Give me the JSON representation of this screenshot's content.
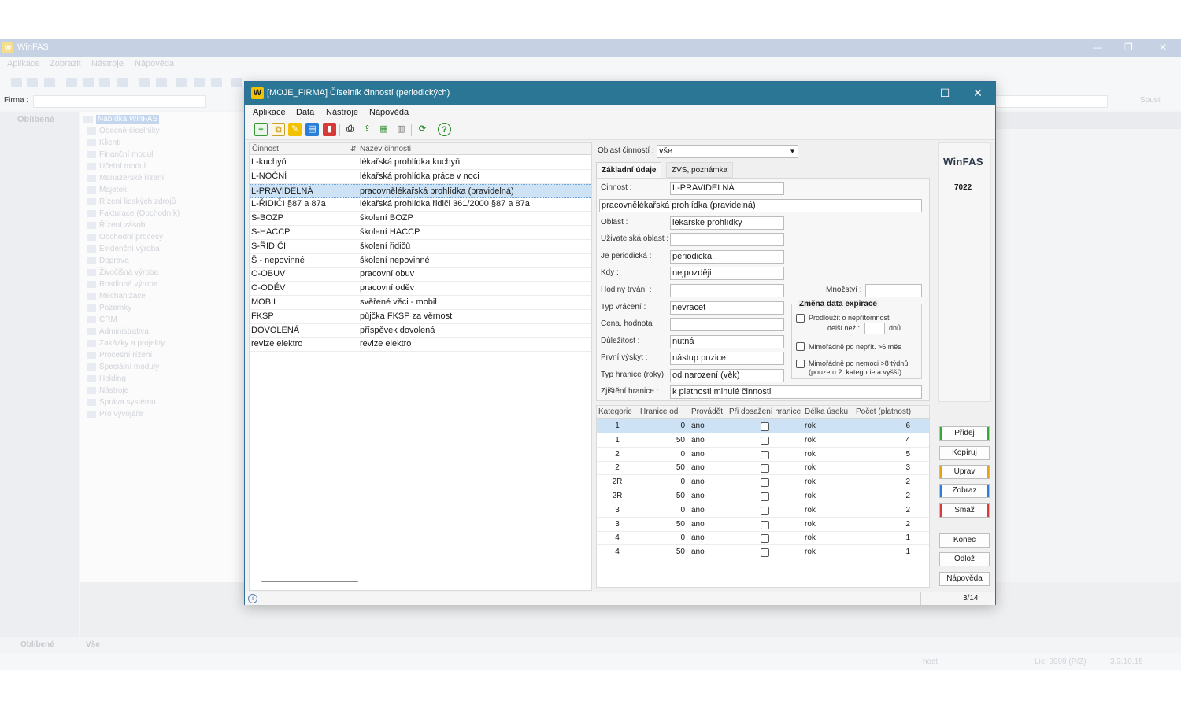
{
  "bg": {
    "title": "WinFAS",
    "menu": [
      "Aplikace",
      "Zobrazit",
      "Nástroje",
      "Nápověda"
    ],
    "firma_label": "Firma :",
    "spust_label": "Spusť",
    "left_heading": "Oblíbené",
    "tree": [
      "Nabídka WinFAS",
      "Obecné číselníky",
      "Klienti",
      "Finanční modul",
      "Účetní modul",
      "Manažerské řízení",
      "Majetek",
      "Řízení lidských zdrojů",
      "Fakturace (Obchodník)",
      "Řízení zásob",
      "Obchodní procesy",
      "Evidenční výroba",
      "Doprava",
      "Živočišná výroba",
      "Rostlinná výroba",
      "Mechanizace",
      "Pozemky",
      "CRM",
      "Administrativa",
      "Zakázky a projekty",
      "Procesní řízení",
      "Speciální moduly",
      "Holding",
      "Nástroje",
      "Správa systému",
      "Pro vývojáře"
    ],
    "bottom_tabs": [
      "Oblíbené",
      "Vše"
    ],
    "status_user": "host",
    "status_lic": "Lic: 9999 (P/Z)",
    "status_ver": "3.3.10.15"
  },
  "dialog": {
    "title": "[MOJE_FIRMA] Číselník činností (periodických)",
    "menu": [
      "Aplikace",
      "Data",
      "Nástroje",
      "Nápověda"
    ],
    "list": {
      "headers": [
        "Činnost",
        "Název činnosti"
      ],
      "rows": [
        {
          "code": "L-kuchyň",
          "name": "lékařská prohlídka kuchyň"
        },
        {
          "code": "L-NOČNÍ",
          "name": "lékařská prohlídka práce v noci"
        },
        {
          "code": "L-PRAVIDELNÁ",
          "name": "pracovnělékařská prohlídka (pravidelná)"
        },
        {
          "code": "L-ŘIDIČI §87 a 87a",
          "name": "lékařská prohlídka řidiči 361/2000 §87 a 87a"
        },
        {
          "code": "S-BOZP",
          "name": "školení BOZP"
        },
        {
          "code": "S-HACCP",
          "name": "školení HACCP"
        },
        {
          "code": "S-ŘIDIČI",
          "name": "školení řidičů"
        },
        {
          "code": "Š - nepovinné",
          "name": "školení nepovinné"
        },
        {
          "code": "O-OBUV",
          "name": "pracovní obuv"
        },
        {
          "code": "O-ODĚV",
          "name": "pracovní oděv"
        },
        {
          "code": "MOBIL",
          "name": "svěřené věci - mobil"
        },
        {
          "code": "FKSP",
          "name": "půjčka FKSP za věrnost"
        },
        {
          "code": "DOVOLENÁ",
          "name": "příspěvek dovolená"
        },
        {
          "code": "revize elektro",
          "name": "revize elektro"
        }
      ]
    },
    "form": {
      "oblast_label": "Oblast činností :",
      "oblast_value": "vše",
      "tab_main": "Základní údaje",
      "tab_zvs": "ZVS, poznámka",
      "cinnost_label": "Činnost :",
      "cinnost_value": "L-PRAVIDELNÁ",
      "nazev_value": "pracovnělékařská prohlídka (pravidelná)",
      "oblast2_label": "Oblast :",
      "oblast2_value": "lékařské prohlídky",
      "uziv_label": "Uživatelská oblast :",
      "uziv_value": "",
      "period_label": "Je periodická :",
      "period_value": "periodická",
      "kdy_label": "Kdy :",
      "kdy_value": "nejpozději",
      "hodiny_label": "Hodiny trvání :",
      "hodiny_value": "",
      "mnozstvi_label": "Množství :",
      "mnozstvi_value": "",
      "typvrac_label": "Typ vrácení :",
      "typvrac_value": "nevracet",
      "cena_label": "Cena, hodnota",
      "cena_value": "",
      "dulez_label": "Důležitost :",
      "dulez_value": "nutná",
      "prvni_label": "První výskyt :",
      "prvni_value": "nástup pozice",
      "typhr_label": "Typ hranice (roky)",
      "typhr_value": "od narození (věk)",
      "zjist_label": "Zjištění hranice :",
      "zjist_value": "k platnosti minulé činnosti",
      "group_title": "Změna data expirace",
      "chk1_line1": "Prodloužit o nepřítomnosti",
      "chk1_line2": "delší než :",
      "chk1_unit": "dnů",
      "chk2": "Mimořádně po nepřít.  >6 měs",
      "chk3_line1": "Mimořádně po nemoci >8 týdnů",
      "chk3_line2": "(pouze u 2. kategorie a vyšší)"
    },
    "grid": {
      "headers": [
        "Kategorie",
        "Hranice od",
        "Provádět",
        "Při dosažení hranice",
        "Délka úseku",
        "Počet (platnost)"
      ],
      "rows": [
        {
          "kat": "1",
          "hr": "0",
          "prov": "ano",
          "del": "rok",
          "poc": "6"
        },
        {
          "kat": "1",
          "hr": "50",
          "prov": "ano",
          "del": "rok",
          "poc": "4"
        },
        {
          "kat": "2",
          "hr": "0",
          "prov": "ano",
          "del": "rok",
          "poc": "5"
        },
        {
          "kat": "2",
          "hr": "50",
          "prov": "ano",
          "del": "rok",
          "poc": "3"
        },
        {
          "kat": "2R",
          "hr": "0",
          "prov": "ano",
          "del": "rok",
          "poc": "2"
        },
        {
          "kat": "2R",
          "hr": "50",
          "prov": "ano",
          "del": "rok",
          "poc": "2"
        },
        {
          "kat": "3",
          "hr": "0",
          "prov": "ano",
          "del": "rok",
          "poc": "2"
        },
        {
          "kat": "3",
          "hr": "50",
          "prov": "ano",
          "del": "rok",
          "poc": "2"
        },
        {
          "kat": "4",
          "hr": "0",
          "prov": "ano",
          "del": "rok",
          "poc": "1"
        },
        {
          "kat": "4",
          "hr": "50",
          "prov": "ano",
          "del": "rok",
          "poc": "1"
        }
      ]
    },
    "brand": "WinFAS",
    "brand_num": "7022",
    "buttons": {
      "pridej": "Přidej",
      "kopiruj": "Kopíruj",
      "uprav": "Uprav",
      "zobraz": "Zobraz",
      "smaz": "Smaž",
      "konec": "Konec",
      "odloz": "Odlož",
      "napoveda": "Nápověda"
    },
    "colors": {
      "pridej": "#3aa63a",
      "uprav": "#e0a21a",
      "zobraz": "#2b7ed6",
      "smaz": "#d83a3a",
      "title": "#2b7694"
    },
    "page": "3/14"
  }
}
